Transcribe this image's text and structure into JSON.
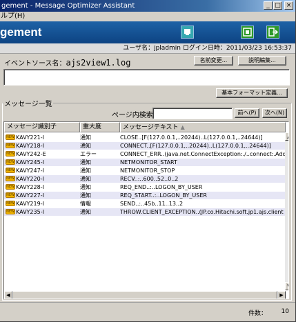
{
  "window": {
    "title": "gement - Message Optimizer Assistant",
    "minimize_glyph": "_",
    "maximize_glyph": "□",
    "close_glyph": "×"
  },
  "menubar": {
    "help_label": "ルプ(H)"
  },
  "banner": {
    "title": "gement"
  },
  "infobar": {
    "user_text": "ユーザ名：jpladmin  ログイン日時：2011/03/23 16:53:37"
  },
  "source": {
    "label": "イベントソース名：",
    "value": "ajs2view1.log",
    "rename_button": "名前変更...",
    "edit_description_button": "説明編集..."
  },
  "basic_format_button": "基本フォーマット定義...",
  "messages": {
    "group_label": "メッセージ一覧",
    "search_label": "ページ内検索：",
    "search_value": "",
    "prev_button": "前へ(P)",
    "next_button": "次へ(N)",
    "columns": [
      "メッセージ識別子",
      "重大度",
      "メッセージテキスト"
    ],
    "sort_glyph": "▲",
    "icon_text": "NEW",
    "rows": [
      {
        "id": "KAVY221-I",
        "severity": "通知",
        "text": "CLOSE..[F(127.0.0.1,..20244)..L(127.0.0.1,..24644)]"
      },
      {
        "id": "KAVY218-I",
        "severity": "通知",
        "text": "CONNECT..[F(127.0.0.1,..20244)..L(127.0.0.1,..24644)]"
      },
      {
        "id": "KAVY242-E",
        "severity": "エラー",
        "text": "CONNECT_ERR..(java.net.ConnectException:./..connect:.Address"
      },
      {
        "id": "KAVY245-I",
        "severity": "通知",
        "text": "NETMONITOR_START"
      },
      {
        "id": "KAVY247-I",
        "severity": "通知",
        "text": "NETMONITOR_STOP"
      },
      {
        "id": "KAVY220-I",
        "severity": "通知",
        "text": "RECV..:..600..52..0..2"
      },
      {
        "id": "KAVY228-I",
        "severity": "通知",
        "text": "REQ_END..:..LOGON_BY_USER"
      },
      {
        "id": "KAVY227-I",
        "severity": "通知",
        "text": "REQ_START..:..LOGON_BY_USER"
      },
      {
        "id": "KAVY219-I",
        "severity": "情報",
        "text": "SEND..:..45b..11..13..2"
      },
      {
        "id": "KAVY235-I",
        "severity": "通知",
        "text": "THROW.CLIENT_EXCEPTION..(JP.co.Hitachi.soft.jp1.ajs.client"
      }
    ]
  },
  "status": {
    "count_label": "件数：",
    "count_value": "10"
  },
  "colors": {
    "banner": "#1e62a6",
    "row_alt": "#e6e6f5",
    "icon": "#f0b400",
    "chrome": "#d4d0c8"
  }
}
